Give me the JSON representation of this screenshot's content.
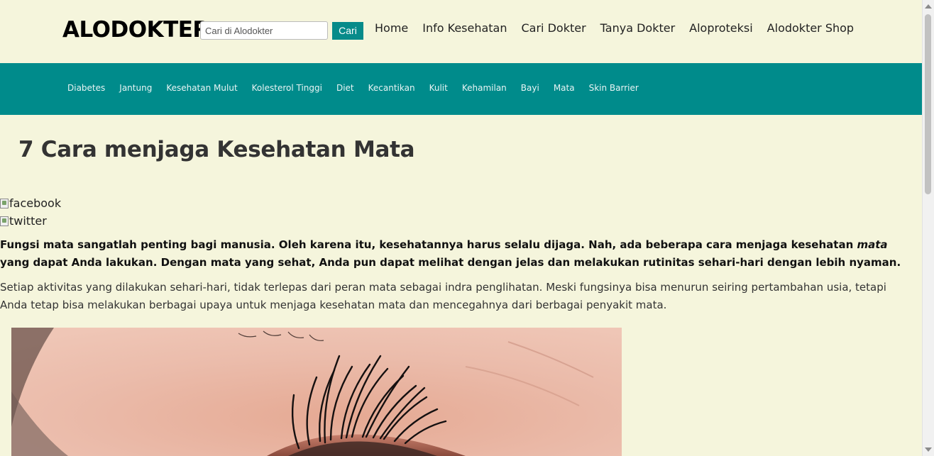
{
  "header": {
    "logo": "ALODOKTER",
    "search": {
      "placeholder": "Cari di Alodokter",
      "button_label": "Cari"
    },
    "nav": [
      "Home",
      "Info Kesehatan",
      "Cari Dokter",
      "Tanya Dokter",
      "Aloproteksi",
      "Alodokter Shop"
    ]
  },
  "categories": [
    "Diabetes",
    "Jantung",
    "Kesehatan Mulut",
    "Kolesterol Tinggi",
    "Diet",
    "Kecantikan",
    "Kulit",
    "Kehamilan",
    "Bayi",
    "Mata",
    "Skin Barrier"
  ],
  "article": {
    "title": "7 Cara menjaga Kesehatan Mata",
    "share": {
      "facebook_alt": "facebook",
      "twitter_alt": "twitter"
    },
    "lead_before": "Fungsi mata sangatlah penting bagi manusia. Oleh karena itu, kesehatannya harus selalu dijaga. Nah, ada beberapa cara menjaga kesehatan ",
    "lead_emphasis": "mata",
    "lead_after": " yang dapat Anda lakukan. Dengan mata yang sehat, Anda pun dapat melihat dengan jelas dan melakukan rutinitas sehari-hari dengan lebih nyaman.",
    "body": "Setiap aktivitas yang dilakukan sehari-hari, tidak terlepas dari peran mata sebagai indra penglihatan. Meski fungsinya bisa menurun seiring pertambahan usia, tetapi Anda tetap bisa melakukan berbagai upaya untuk menjaga kesehatan mata dan mencegahnya dari berbagai penyakit mata."
  },
  "colors": {
    "background": "#f5f5dc",
    "accent": "#008b8b",
    "button": "#078b8a"
  }
}
